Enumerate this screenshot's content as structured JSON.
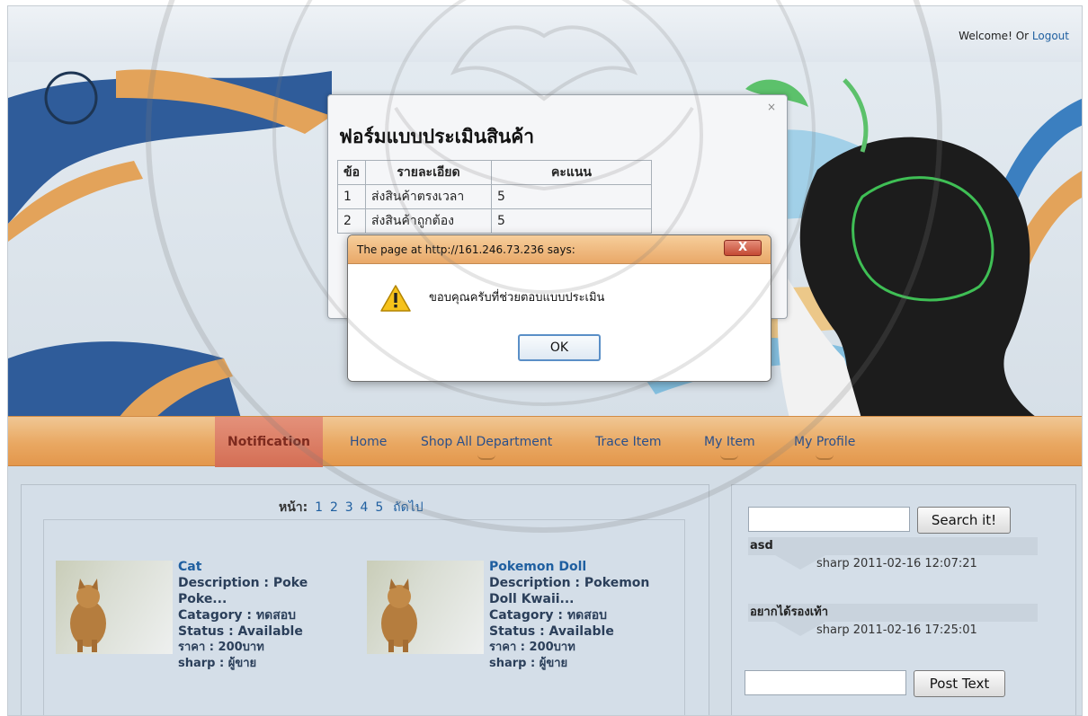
{
  "header": {
    "welcome_text": "Welcome! Or",
    "logout_label": "Logout"
  },
  "nav": {
    "items": [
      {
        "label": "Notification"
      },
      {
        "label": "Home"
      },
      {
        "label": "Shop All Department"
      },
      {
        "label": "Trace Item"
      },
      {
        "label": "My Item"
      },
      {
        "label": "My Profile"
      }
    ]
  },
  "pager": {
    "label": "หน้า:",
    "pages": [
      "1",
      "2",
      "3",
      "4",
      "5"
    ],
    "next_label": "ถัดไป"
  },
  "products": [
    {
      "name": "Cat",
      "description": "Description : Poke Poke...",
      "category": "Catagory : ทดสอบ",
      "status": "Status : Available",
      "price": "ราคา : 200บาท",
      "seller": "sharp : ผู้ขาย"
    },
    {
      "name": "Pokemon Doll",
      "description": "Description : Pokemon",
      "description_line2": "Doll Kwaii...",
      "category": "Catagory : ทดสอบ",
      "status": "Status : Available",
      "price": "ราคา : 200บาท",
      "seller": "sharp : ผู้ขาย"
    }
  ],
  "sidebar": {
    "search_value": "",
    "search_button": "Search it!",
    "posts": [
      {
        "title": "asd",
        "meta": "sharp 2011-02-16 12:07:21"
      },
      {
        "title": "อยากได้รองเท้า",
        "meta": "sharp 2011-02-16 17:25:01"
      }
    ],
    "post_value": "",
    "post_button": "Post Text"
  },
  "survey_dialog": {
    "close": "×",
    "title": "ฟอร์มแบบประเมินสินค้า",
    "headers": [
      "ข้อ",
      "รายละเอียด",
      "คะแนน"
    ],
    "rows": [
      {
        "no": "1",
        "detail": "ส่งสินค้าตรงเวลา",
        "score": "5"
      },
      {
        "no": "2",
        "detail": "ส่งสินค้าถูกต้อง",
        "score": "5"
      }
    ]
  },
  "alert": {
    "title": "The page at http://161.246.73.236 says:",
    "close": "X",
    "message": "ขอบคุณครับที่ช่วยตอบแบบประเมิน",
    "ok_label": "OK"
  },
  "colors": {
    "nav_bg": "#e9a862",
    "nav_active": "#d46e54",
    "link": "#1f5fa0"
  }
}
